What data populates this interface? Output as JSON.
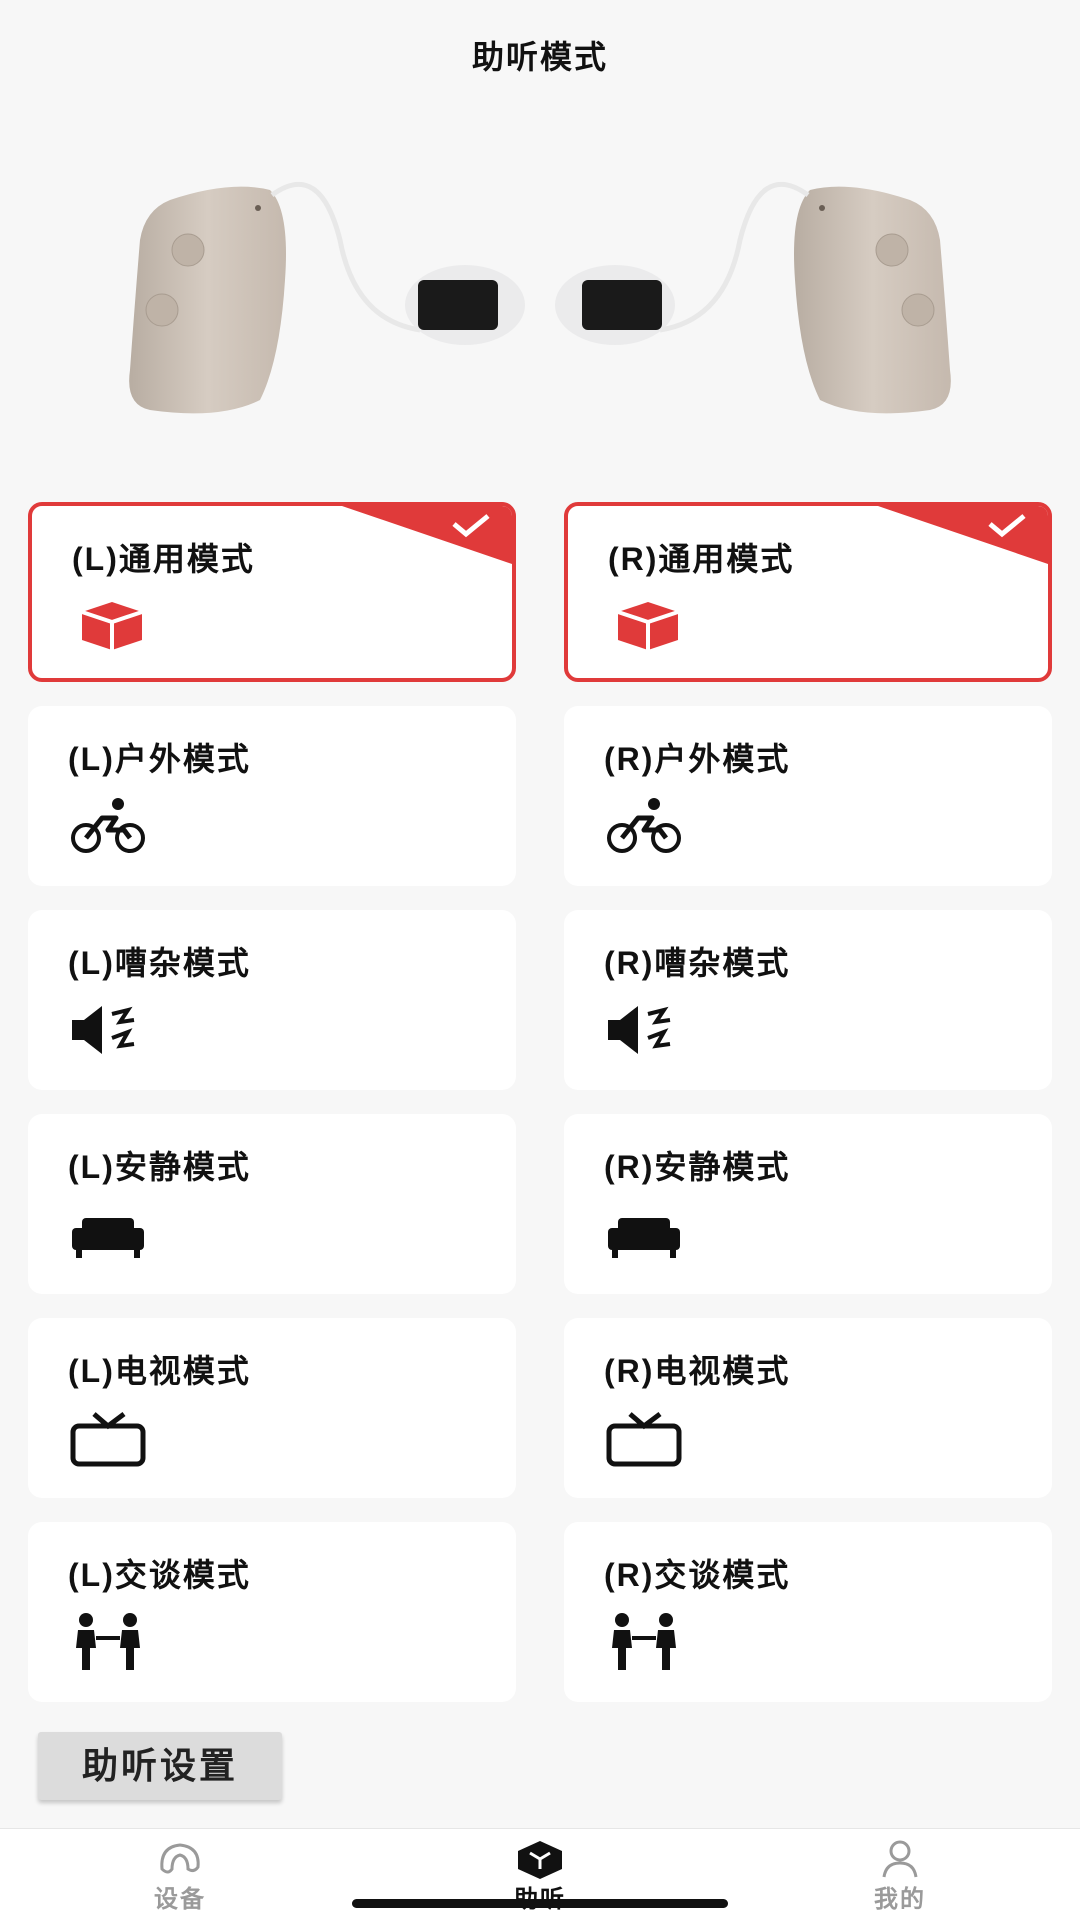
{
  "header": {
    "title": "助听模式"
  },
  "colors": {
    "accent": "#e03a3a",
    "background": "#f7f7f7",
    "card": "#ffffff"
  },
  "modes": [
    {
      "left": "(L)通用模式",
      "right": "(R)通用模式",
      "icon": "cube-icon",
      "selected": true
    },
    {
      "left": "(L)户外模式",
      "right": "(R)户外模式",
      "icon": "bicycle-icon",
      "selected": false
    },
    {
      "left": "(L)嘈杂模式",
      "right": "(R)嘈杂模式",
      "icon": "speaker-noise-icon",
      "selected": false
    },
    {
      "left": "(L)安静模式",
      "right": "(R)安静模式",
      "icon": "sofa-icon",
      "selected": false
    },
    {
      "left": "(L)电视模式",
      "right": "(R)电视模式",
      "icon": "tv-icon",
      "selected": false
    },
    {
      "left": "(L)交谈模式",
      "right": "(R)交谈模式",
      "icon": "people-talking-icon",
      "selected": false
    }
  ],
  "settings_button": {
    "label": "助听设置"
  },
  "tabbar": {
    "tabs": [
      {
        "label": "设备",
        "icon": "device-icon",
        "active": false
      },
      {
        "label": "助听",
        "icon": "hearing-cube-icon",
        "active": true
      },
      {
        "label": "我的",
        "icon": "user-icon",
        "active": false
      }
    ]
  }
}
